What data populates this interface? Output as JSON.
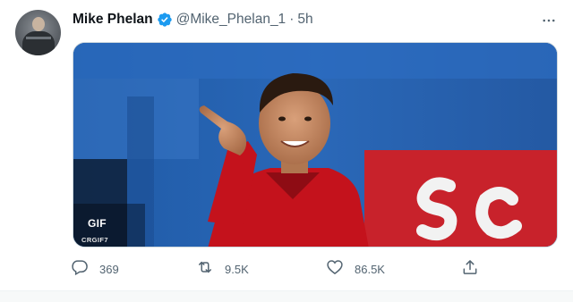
{
  "tweet": {
    "author": {
      "display_name": "Mike Phelan",
      "handle": "@Mike_Phelan_1",
      "verified": true
    },
    "separator": "·",
    "time": "5h",
    "media": {
      "type": "gif",
      "badge": "GIF",
      "credit": "CRGIF7"
    },
    "actions": {
      "reply_count": "369",
      "retweet_count": "9.5K",
      "like_count": "86.5K"
    }
  },
  "icons": {
    "more": "more-icon",
    "verified": "verified-badge-icon",
    "reply": "reply-icon",
    "retweet": "retweet-icon",
    "like": "heart-icon",
    "share": "share-icon"
  },
  "colors": {
    "verified_blue": "#1d9bf0",
    "secondary_text": "#536471",
    "primary_text": "#0f1419"
  }
}
